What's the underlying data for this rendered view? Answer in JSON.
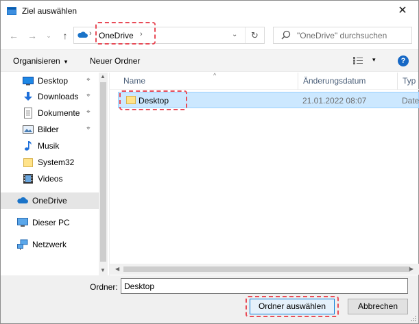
{
  "window": {
    "title": "Ziel auswählen",
    "close_glyph": "✕"
  },
  "nav": {
    "back_glyph": "←",
    "forward_glyph": "→",
    "recent_glyph": "⌄",
    "up_glyph": "↑"
  },
  "address": {
    "location": "OneDrive",
    "separator": "›",
    "refresh_glyph": "↻",
    "dropdown_glyph": "⌄"
  },
  "search": {
    "placeholder": "\"OneDrive\" durchsuchen"
  },
  "toolbar": {
    "organize_label": "Organisieren",
    "organize_caret": "▾",
    "new_folder_label": "Neuer Ordner",
    "view_caret": "▾",
    "help_label": "?"
  },
  "sidebar": {
    "items": [
      {
        "label": "Desktop",
        "icon": "desktop-icon",
        "pinned": true
      },
      {
        "label": "Downloads",
        "icon": "download-icon",
        "pinned": true
      },
      {
        "label": "Dokumente",
        "icon": "document-icon",
        "pinned": true
      },
      {
        "label": "Bilder",
        "icon": "picture-icon",
        "pinned": true
      },
      {
        "label": "Musik",
        "icon": "music-icon",
        "pinned": false
      },
      {
        "label": "System32",
        "icon": "folder-icon",
        "pinned": false
      },
      {
        "label": "Videos",
        "icon": "video-icon",
        "pinned": false
      },
      {
        "label": "OneDrive",
        "icon": "cloud-icon",
        "selected": true
      },
      {
        "label": "Dieser PC",
        "icon": "computer-icon"
      },
      {
        "label": "Netzwerk",
        "icon": "network-icon"
      }
    ],
    "pin_glyph": "📌"
  },
  "file_list": {
    "columns": [
      "Name",
      "Änderungsdatum",
      "Typ"
    ],
    "sort_glyph": "^",
    "rows": [
      {
        "name": "Desktop",
        "date": "21.01.2022 08:07",
        "type": "Datei"
      }
    ]
  },
  "scroll": {
    "up": "▲",
    "down": "▼",
    "left": "◀",
    "right": "▶"
  },
  "bottom": {
    "folder_label": "Ordner:",
    "folder_value": "Desktop",
    "select_button": "Ordner auswählen",
    "cancel_button": "Abbrechen"
  },
  "colors": {
    "accent": "#0078d7",
    "selection": "#cce8ff",
    "highlight": "#e84b57",
    "folder": "#ffd966"
  }
}
